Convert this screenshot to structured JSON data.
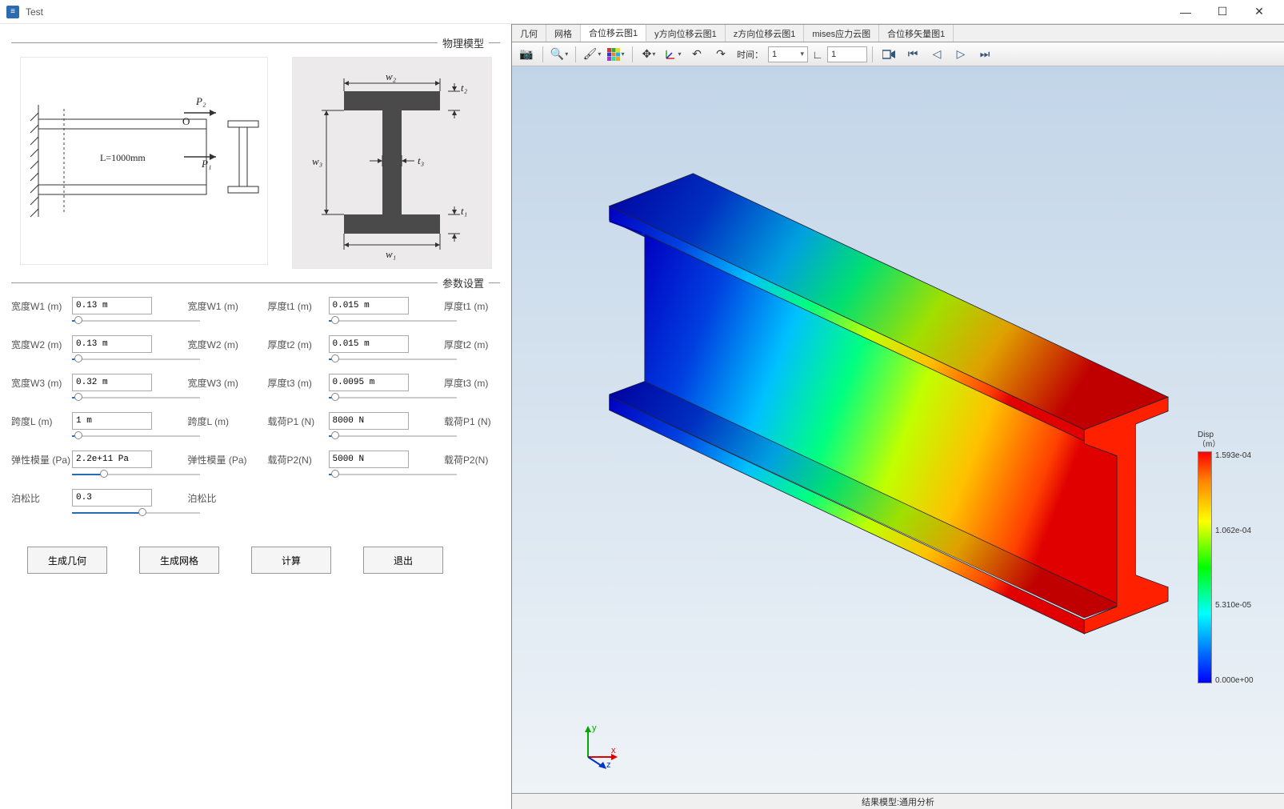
{
  "window": {
    "title": "Test"
  },
  "sections": {
    "physics_model": "物理模型",
    "param_settings": "参数设置"
  },
  "diagram": {
    "beam": {
      "length_label": "L=1000mm",
      "p1": "P₁",
      "p2": "P₂",
      "origin": "O"
    },
    "section": {
      "w1": "w₁",
      "w2": "w₂",
      "w3": "w₃",
      "t1": "t₁",
      "t2": "t₂",
      "t3": "t₃"
    }
  },
  "params": {
    "left": [
      {
        "label": "宽度W1 (m)",
        "value": "0.13 m",
        "unit": "宽度W1 (m)",
        "fill": 5
      },
      {
        "label": "宽度W2 (m)",
        "value": "0.13 m",
        "unit": "宽度W2 (m)",
        "fill": 5
      },
      {
        "label": "宽度W3 (m)",
        "value": "0.32 m",
        "unit": "宽度W3 (m)",
        "fill": 5
      },
      {
        "label": "跨度L (m)",
        "value": "1 m",
        "unit": "跨度L (m)",
        "fill": 5
      },
      {
        "label": "弹性模量 (Pa)",
        "value": "2.2e+11 Pa",
        "unit": "弹性模量 (Pa)",
        "fill": 25
      },
      {
        "label": "泊松比",
        "value": "0.3",
        "unit": "泊松比",
        "fill": 55
      }
    ],
    "right": [
      {
        "label": "厚度t1 (m)",
        "value": "0.015 m",
        "unit": "厚度t1 (m)",
        "fill": 5
      },
      {
        "label": "厚度t2 (m)",
        "value": "0.015 m",
        "unit": "厚度t2 (m)",
        "fill": 5
      },
      {
        "label": "厚度t3 (m)",
        "value": "0.0095 m",
        "unit": "厚度t3 (m)",
        "fill": 5
      },
      {
        "label": "载荷P1 (N)",
        "value": "8000 N",
        "unit": "载荷P1 (N)",
        "fill": 5
      },
      {
        "label": "载荷P2(N)",
        "value": "5000 N",
        "unit": "载荷P2(N)",
        "fill": 5
      }
    ]
  },
  "buttons": {
    "gen_geometry": "生成几何",
    "gen_mesh": "生成网格",
    "compute": "计算",
    "exit": "退出"
  },
  "tabs": [
    "几何",
    "网格",
    "合位移云图1",
    "y方向位移云图1",
    "z方向位移云图1",
    "mises应力云图",
    "合位移矢量图1"
  ],
  "active_tab": 2,
  "toolbar": {
    "time_label": "时间：",
    "time_value": "1",
    "frame_value": "1"
  },
  "legend": {
    "title_line1": "Disp",
    "title_line2": "（m）",
    "ticks": [
      "1.593e-04",
      "1.062e-04",
      "5.310e-05",
      "0.000e+00"
    ]
  },
  "status": "结果模型:通用分析",
  "axis_labels": {
    "x": "x",
    "y": "y",
    "z": "z"
  }
}
